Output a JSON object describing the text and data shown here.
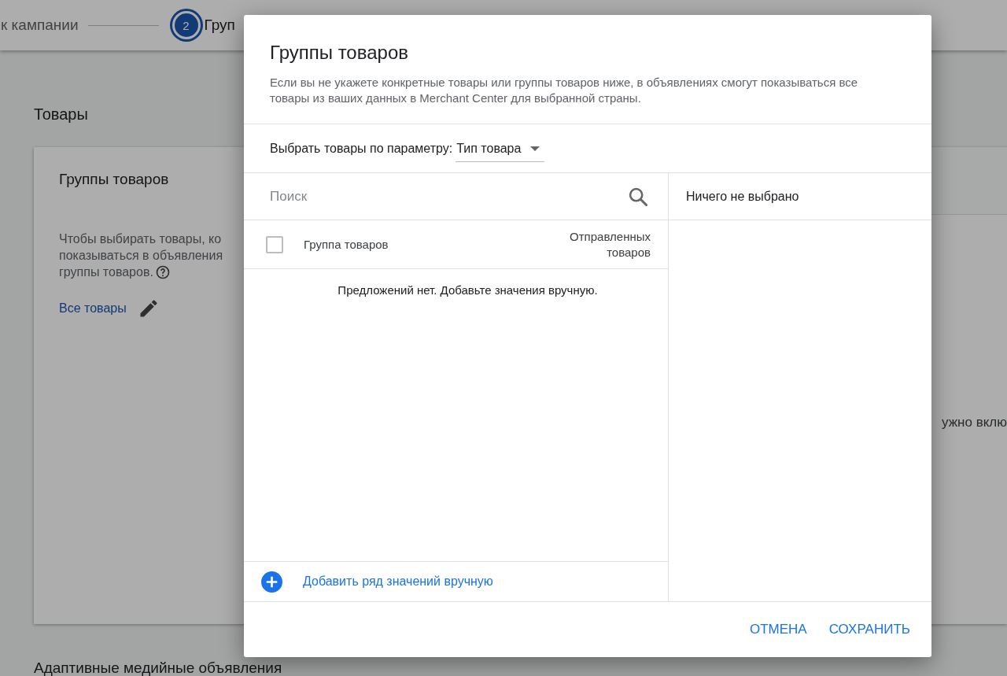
{
  "stepper": {
    "steps": [
      {
        "label": "к кампании",
        "selected": false
      },
      {
        "number": "2",
        "label": "Груп",
        "selected": true
      }
    ]
  },
  "page": {
    "section_title": "Товары",
    "card": {
      "title": "Группы товаров",
      "description_lines": [
        "Чтобы выбирать товары, ко",
        "показываться в объявления",
        "группы товаров."
      ],
      "link": "Все товары",
      "side_text": "ужно вклю"
    },
    "next_section_title": "Адаптивные медийные объявления"
  },
  "dialog": {
    "title": "Группы товаров",
    "description": "Если вы не укажете конкретные товары или группы товаров ниже, в объявлениях смогут показываться все товары из ваших данных в Merchant Center для выбранной страны.",
    "filter": {
      "label": "Выбрать товары по параметру:",
      "value": "Тип товара"
    },
    "search": {
      "placeholder": "Поиск"
    },
    "table": {
      "select_all": {
        "checked": false
      },
      "columns": [
        "Группа товаров",
        "Отправленных товаров"
      ],
      "empty_message": "Предложений нет. Добавьте значения вручную."
    },
    "add_link": "Добавить ряд значений вручную",
    "selected_panel": {
      "empty_message": "Ничего не выбрано"
    },
    "buttons": [
      "ОТМЕНА",
      "СОХРАНИТЬ"
    ]
  }
}
